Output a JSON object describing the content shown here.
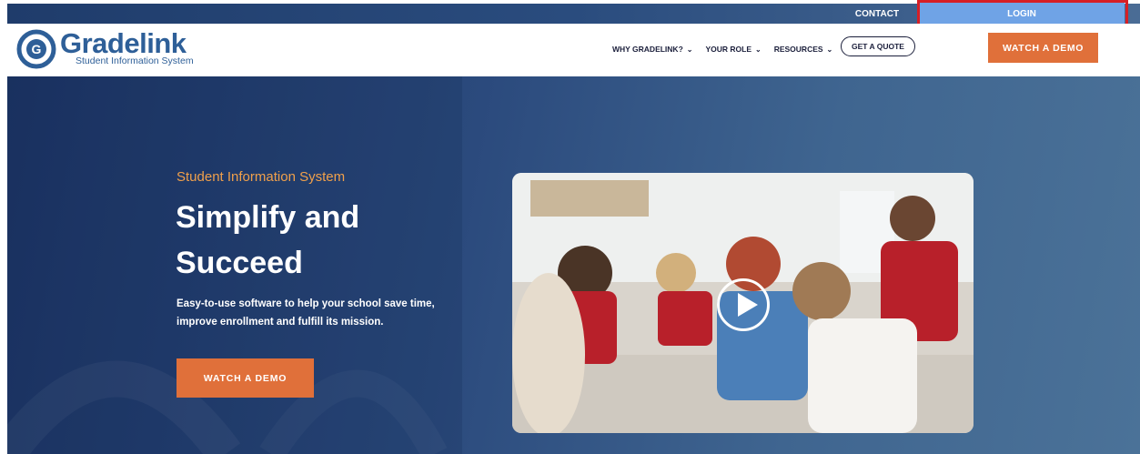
{
  "topbar": {
    "contact_label": "CONTACT",
    "login_label": "LOGIN"
  },
  "header": {
    "logo_word": "Gradelink",
    "logo_sub": "Student Information System",
    "nav": [
      {
        "label": "WHY GRADELINK?",
        "chevron": "⌄"
      },
      {
        "label": "YOUR ROLE",
        "chevron": "⌄"
      },
      {
        "label": "RESOURCES",
        "chevron": "⌄"
      }
    ],
    "quote_label": "GET A QUOTE",
    "demo_label": "WATCH A DEMO"
  },
  "hero": {
    "eyebrow": "Student Information System",
    "headline": "Simplify and Succeed",
    "subcopy": "Easy-to-use software to help your school save time, improve enrollment and fulfill its mission.",
    "demo_label": "WATCH A DEMO",
    "video_icon": "play-icon"
  },
  "colors": {
    "accent_orange": "#e0703a",
    "brand_blue": "#2e5f98",
    "hero_dark": "#1d3566",
    "login_bg": "#6fa3e6",
    "highlight_red": "#d61f26"
  }
}
